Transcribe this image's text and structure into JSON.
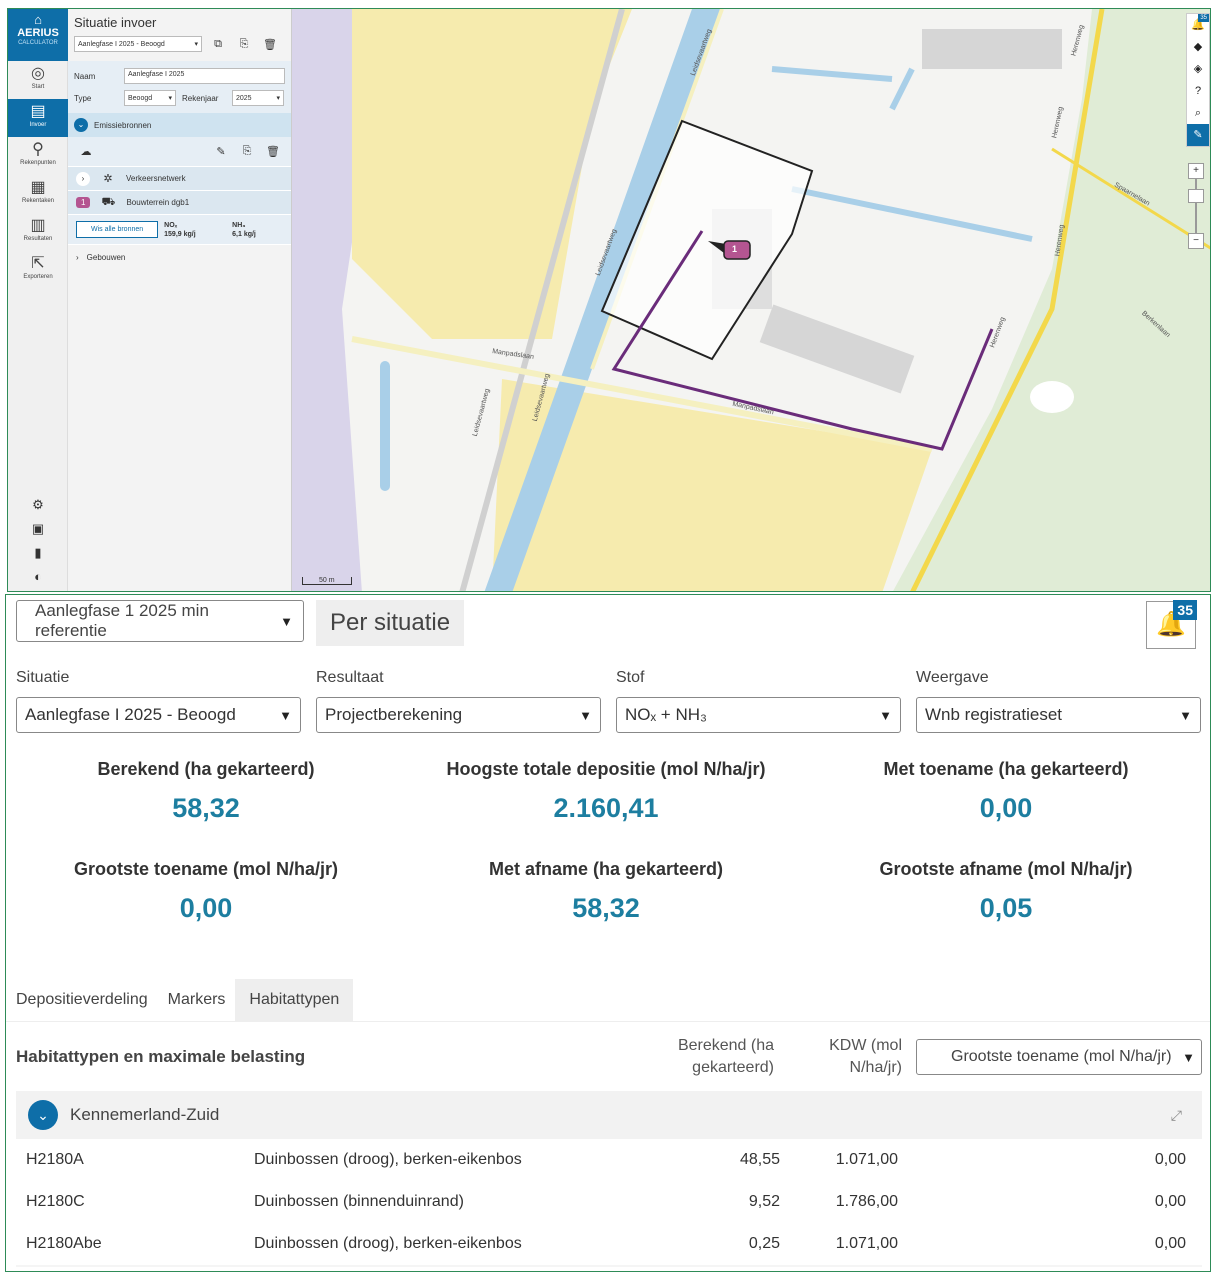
{
  "sidebar": {
    "logo_title": "AERIUS",
    "logo_subtitle": "CALCULATOR",
    "items": [
      {
        "label": "Start"
      },
      {
        "label": "Invoer"
      },
      {
        "label": "Rekenpunten"
      },
      {
        "label": "Rekentaken"
      },
      {
        "label": "Resultaten"
      },
      {
        "label": "Exporteren"
      }
    ]
  },
  "panel": {
    "title": "Situatie invoer",
    "situation_select": "Aanlegfase I 2025 - Beoogd",
    "name_label": "Naam",
    "name_value": "Aanlegfase I 2025",
    "type_label": "Type",
    "type_value": "Beoogd",
    "year_label": "Rekenjaar",
    "year_value": "2025",
    "emission_section": "Emissiebronnen",
    "source_traffic": "Verkeersnetwerk",
    "source_badge": "1",
    "source_building_site": "Bouwterrein dgb1",
    "clear_button": "Wis alle bronnen",
    "nox_label": "NOₓ",
    "nox_value": "159,9 kg/j",
    "nh3_label": "NH₃",
    "nh3_value": "6,1 kg/j",
    "buildings_section": "Gebouwen"
  },
  "map": {
    "toolbar_badge": "35",
    "marker_label": "1",
    "scale_label": "50 m",
    "streets": [
      "Leidsevaartweg",
      "Leidsevaartweg",
      "Leidsevaartweg",
      "Leidsevaartweg",
      "Manpadslaan",
      "Manpadslaan",
      "Herenweg",
      "Herenweg",
      "Herenweg",
      "Spaarnelaan",
      "Berkenlaan",
      "Herenweg"
    ]
  },
  "results": {
    "comparison_select": "Aanlegfase 1 2025 min referentie",
    "view_title": "Per situatie",
    "notification_count": "35",
    "filters": [
      {
        "label": "Situatie",
        "value": "Aanlegfase I 2025 - Beoogd"
      },
      {
        "label": "Resultaat",
        "value": "Projectberekening"
      },
      {
        "label": "Stof",
        "value": "NOₓ + NH₃"
      },
      {
        "label": "Weergave",
        "value": "Wnb registratieset"
      }
    ],
    "stats": [
      {
        "label": "Berekend (ha gekarteerd)",
        "value": "58,32"
      },
      {
        "label": "Hoogste totale depositie (mol N/ha/jr)",
        "value": "2.160,41"
      },
      {
        "label": "Met toename (ha gekarteerd)",
        "value": "0,00"
      },
      {
        "label": "Grootste toename (mol N/ha/jr)",
        "value": "0,00"
      },
      {
        "label": "Met afname (ha gekarteerd)",
        "value": "58,32"
      },
      {
        "label": "Grootste afname (mol N/ha/jr)",
        "value": "0,05"
      }
    ],
    "tabs": [
      "Depositieverdeling",
      "Markers",
      "Habitattypen"
    ],
    "table": {
      "title": "Habitattypen en maximale belasting",
      "col_computed": "Berekend (ha gekarteerd)",
      "col_kdw": "KDW (mol N/ha/jr)",
      "sort_select": "Grootste toename (mol N/ha/jr)",
      "group_name": "Kennemerland-Zuid",
      "rows": [
        {
          "code": "H2180A",
          "name": "Duinbossen (droog), berken-eikenbos",
          "computed": "48,55",
          "kdw": "1.071,00",
          "value": "0,00"
        },
        {
          "code": "H2180C",
          "name": "Duinbossen (binnenduinrand)",
          "computed": "9,52",
          "kdw": "1.786,00",
          "value": "0,00"
        },
        {
          "code": "H2180Abe",
          "name": "Duinbossen (droog), berken-eikenbos",
          "computed": "0,25",
          "kdw": "1.071,00",
          "value": "0,00"
        }
      ]
    }
  },
  "colors": {
    "accent": "#0e6ea8",
    "value_text": "#1d7ea0",
    "marker": "#b45591",
    "route": "#6a2c7a"
  }
}
